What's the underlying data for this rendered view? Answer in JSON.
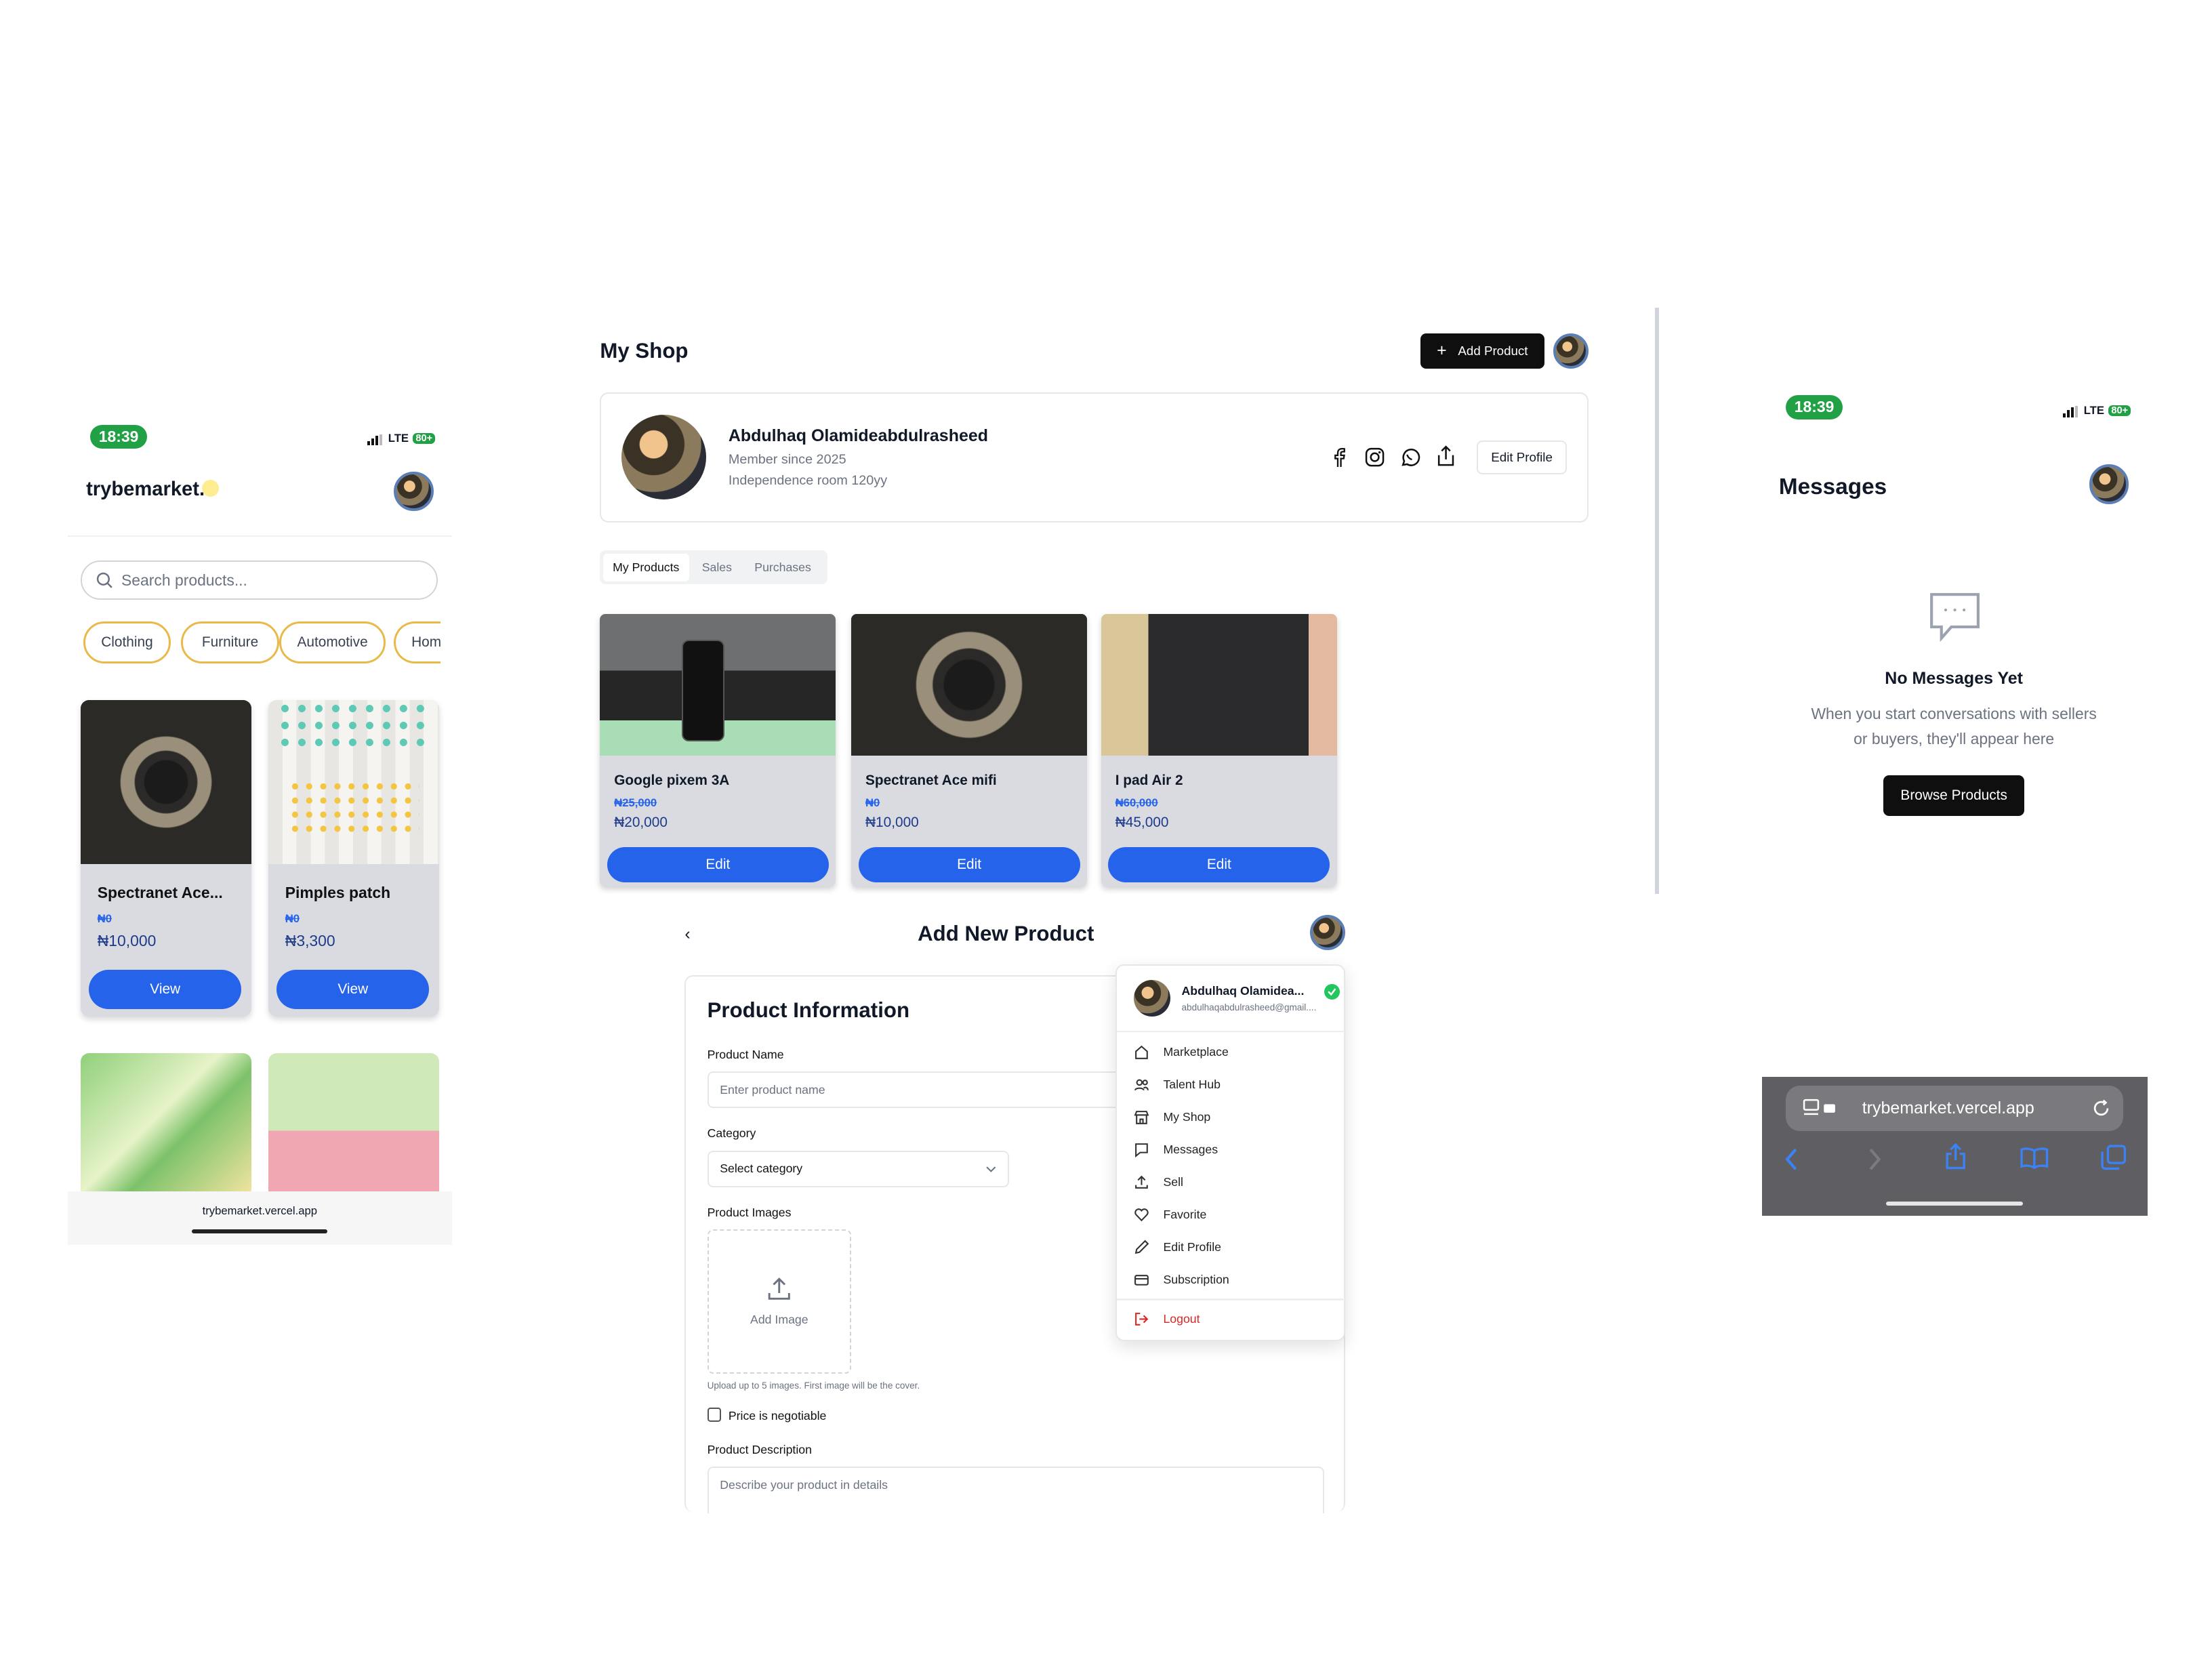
{
  "left_phone": {
    "status": {
      "time": "18:39",
      "network": "LTE",
      "battery": "80+"
    },
    "brand": "trybemarket.",
    "search": {
      "placeholder": "Search products..."
    },
    "categories": [
      "Clothing",
      "Furniture",
      "Automotive",
      "Hom"
    ],
    "products": [
      {
        "title": "Spectranet Ace...",
        "old_price": "₦0",
        "price": "₦10,000",
        "action": "View"
      },
      {
        "title": "Pimples patch",
        "old_price": "₦0",
        "price": "₦3,300",
        "action": "View"
      }
    ],
    "url": "trybemarket.vercel.app"
  },
  "shop": {
    "title": "My Shop",
    "add_product": "Add Product",
    "profile": {
      "name": "Abdulhaq Olamideabdulrasheed",
      "member_since": "Member since 2025",
      "location": "Independence room 120yy",
      "edit_profile": "Edit Profile"
    },
    "social_icons": [
      "facebook-icon",
      "instagram-icon",
      "whatsapp-icon",
      "share-icon"
    ],
    "tabs": [
      "My Products",
      "Sales",
      "Purchases"
    ],
    "products": [
      {
        "title": "Google pixem 3A",
        "old_price": "₦25,000",
        "price": "₦20,000",
        "action": "Edit"
      },
      {
        "title": "Spectranet Ace mifi",
        "old_price": "₦0",
        "price": "₦10,000",
        "action": "Edit"
      },
      {
        "title": "I pad Air 2",
        "old_price": "₦60,000",
        "price": "₦45,000",
        "action": "Edit"
      }
    ]
  },
  "add_product": {
    "title": "Add New Product",
    "section_title": "Product Information",
    "product_name_label": "Product Name",
    "product_name_placeholder": "Enter product name",
    "category_label": "Category",
    "category_value": "Select category",
    "images_label": "Product Images",
    "add_image": "Add Image",
    "upload_hint": "Upload up to 5 images. First image will be the cover.",
    "negotiable_label": "Price is negotiable",
    "description_label": "Product Description",
    "description_placeholder": "Describe your product in details"
  },
  "user_menu": {
    "name": "Abdulhaq Olamidea...",
    "email": "abdulhaqabdulrasheed@gmail....",
    "items": [
      {
        "label": "Marketplace",
        "icon": "home-icon"
      },
      {
        "label": "Talent Hub",
        "icon": "users-icon"
      },
      {
        "label": "My Shop",
        "icon": "store-icon"
      },
      {
        "label": "Messages",
        "icon": "message-icon"
      },
      {
        "label": "Sell",
        "icon": "upload-icon"
      },
      {
        "label": "Favorite",
        "icon": "heart-icon"
      },
      {
        "label": "Edit Profile",
        "icon": "pencil-icon"
      },
      {
        "label": "Subscription",
        "icon": "card-icon"
      }
    ],
    "logout": "Logout",
    "colors": {
      "logout": "#dc2626",
      "verified": "#22c55e"
    }
  },
  "messages": {
    "status": {
      "time": "18:39",
      "network": "LTE",
      "battery": "80+"
    },
    "title": "Messages",
    "empty_title": "No Messages Yet",
    "empty_text_1": "When you start conversations with sellers",
    "empty_text_2": "or buyers, they'll appear here",
    "browse": "Browse Products"
  },
  "safari": {
    "url": "trybemarket.vercel.app"
  },
  "colors": {
    "accent": "#2563eb",
    "chip_border": "#e9b949",
    "status_green": "#22a045"
  }
}
